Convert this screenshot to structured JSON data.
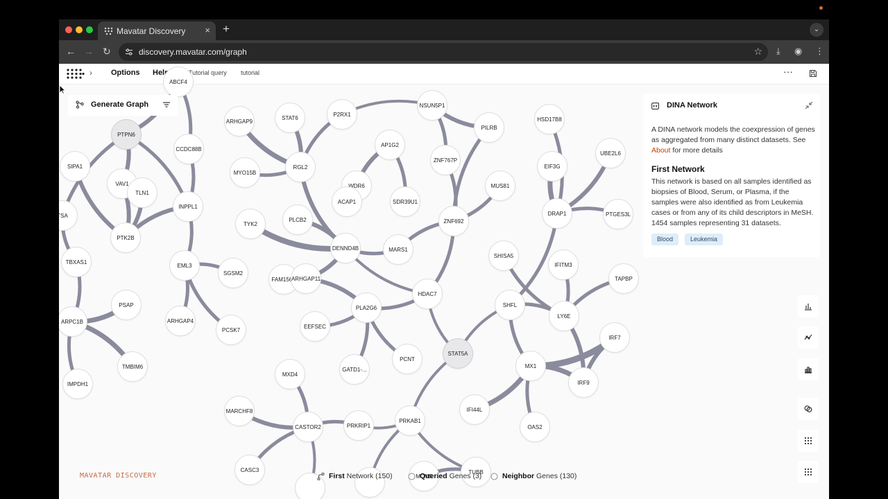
{
  "browser": {
    "tab_title": "Mavatar Discovery",
    "url": "discovery.mavatar.com/graph"
  },
  "app": {
    "menu": [
      "Options",
      "Help"
    ],
    "breadcrumbs": [
      "Tutorial query",
      "tutorial"
    ]
  },
  "toolbar": {
    "generate_label": "Generate Graph"
  },
  "panel": {
    "title": "DINA Network",
    "desc_before_link": "A DINA network models the coexpression of genes as aggregated from many distinct datasets. See ",
    "link": "About",
    "desc_after_link": " for more details",
    "section_title": "First Network",
    "section_desc": "This network is based on all samples identified as biopsies of Blood, Serum, or Plasma, if the samples were also identified as from Leukemia cases or from any of its child descriptors in MeSH. 1454 samples representing 31 datasets.",
    "tags": [
      "Blood",
      "Leukemia"
    ]
  },
  "brand": "MAVATAR DISCOVERY",
  "legend": {
    "first_bold": "First",
    "first_rest": " Network (150)",
    "queried_bold": "Queried",
    "queried_rest": " Genes (3)",
    "neighbor_bold": "Neighbor",
    "neighbor_rest": " Genes (130)"
  },
  "colors": {
    "edge": "#8a8b9c",
    "accent_link": "#c2410c",
    "brand": "#c46a4a",
    "tag_bg": "#e0ecf8"
  },
  "icons": {
    "generate": "graph-share-icon",
    "filter": "filter-lines-icon",
    "panel_close": "collapse-arrows-icon",
    "side_tools": [
      "bar-chart-icon",
      "scatter-icon",
      "histogram-icon",
      "circles-overlap-icon",
      "grid-dots-icon",
      "grid-dots-icon"
    ]
  },
  "graph": {
    "nodes": [
      {
        "id": "ABC",
        "label": "ABCF4",
        "q": false
      },
      {
        "id": "PTPN6",
        "label": "PTPN6",
        "q": true
      },
      {
        "id": "CCDC88B",
        "label": "CCDC88B",
        "q": false
      },
      {
        "id": "ARHGAP9",
        "label": "ARHGAP9",
        "q": false
      },
      {
        "id": "STAT6",
        "label": "STAT6",
        "q": false
      },
      {
        "id": "P2RX1",
        "label": "P2RX1",
        "q": false
      },
      {
        "id": "NSUN5P1",
        "label": "NSUN5P1",
        "q": false
      },
      {
        "id": "PILRB",
        "label": "PILRB",
        "q": false
      },
      {
        "id": "HSD17B8",
        "label": "HSD17B8",
        "q": false
      },
      {
        "id": "UBE2L6",
        "label": "UBE2L6",
        "q": false
      },
      {
        "id": "SIPA1",
        "label": "SIPA1",
        "q": false
      },
      {
        "id": "VAV1",
        "label": "VAV1",
        "q": false
      },
      {
        "id": "TLN1",
        "label": "TLN1",
        "q": false
      },
      {
        "id": "INPPL1",
        "label": "INPPL1",
        "q": false
      },
      {
        "id": "MYO15B",
        "label": "MYO15B",
        "q": false
      },
      {
        "id": "RGL2",
        "label": "RGL2",
        "q": false
      },
      {
        "id": "AP1G2",
        "label": "AP1G2",
        "q": false
      },
      {
        "id": "ZNF767P",
        "label": "ZNF767P",
        "q": false
      },
      {
        "id": "EIF3G",
        "label": "EIF3G",
        "q": false
      },
      {
        "id": "WDR6",
        "label": "WDR6",
        "q": false
      },
      {
        "id": "ACAP1",
        "label": "ACAP1",
        "q": false
      },
      {
        "id": "SDR39U1",
        "label": "SDR39U1",
        "q": false
      },
      {
        "id": "MUS81",
        "label": "MUS81",
        "q": false
      },
      {
        "id": "TSA",
        "label": "TSA",
        "q": false
      },
      {
        "id": "PTK2B",
        "label": "PTK2B",
        "q": false
      },
      {
        "id": "TYK2",
        "label": "TYK2",
        "q": false
      },
      {
        "id": "PLCB2",
        "label": "PLCB2",
        "q": false
      },
      {
        "id": "ZNF692",
        "label": "ZNF692",
        "q": false
      },
      {
        "id": "DRAP1",
        "label": "DRAP1",
        "q": false
      },
      {
        "id": "PTGES3L",
        "label": "PTGES3L",
        "q": false
      },
      {
        "id": "DENND4B",
        "label": "DENND4B",
        "q": false
      },
      {
        "id": "MARS1",
        "label": "MARS1",
        "q": false
      },
      {
        "id": "TBXAS1",
        "label": "TBXAS1",
        "q": false
      },
      {
        "id": "EML3",
        "label": "EML3",
        "q": false
      },
      {
        "id": "SGSM2",
        "label": "SGSM2",
        "q": false
      },
      {
        "id": "FAM156B",
        "label": "FAM156B",
        "q": false
      },
      {
        "id": "ARHGAP11",
        "label": "ARHGAP11",
        "q": false
      },
      {
        "id": "SHISA5",
        "label": "SHISA5",
        "q": false
      },
      {
        "id": "IFITM3",
        "label": "IFITM3",
        "q": false
      },
      {
        "id": "TAPBP",
        "label": "TAPBP",
        "q": false
      },
      {
        "id": "HDAC7",
        "label": "HDAC7",
        "q": false
      },
      {
        "id": "PSAP",
        "label": "PSAP",
        "q": false
      },
      {
        "id": "ARPC1B",
        "label": "ARPC1B",
        "q": false
      },
      {
        "id": "ARHGAP4",
        "label": "ARHGAP4",
        "q": false
      },
      {
        "id": "PCSK7",
        "label": "PCSK7",
        "q": false
      },
      {
        "id": "PLA2G6",
        "label": "PLA2G6",
        "q": false
      },
      {
        "id": "SHFL",
        "label": "SHFL",
        "q": false
      },
      {
        "id": "LY6E",
        "label": "LY6E",
        "q": false
      },
      {
        "id": "EEFSEC",
        "label": "EEFSEC",
        "q": false
      },
      {
        "id": "IRF7",
        "label": "IRF7",
        "q": false
      },
      {
        "id": "STAT5A",
        "label": "STAT5A",
        "q": true
      },
      {
        "id": "PCNT",
        "label": "PCNT",
        "q": false
      },
      {
        "id": "TMBIM6",
        "label": "TMBIM6",
        "q": false
      },
      {
        "id": "GATD1",
        "label": "GATD1-...",
        "q": false
      },
      {
        "id": "MX1",
        "label": "MX1",
        "q": false
      },
      {
        "id": "MXD4",
        "label": "MXD4",
        "q": false
      },
      {
        "id": "IRF9",
        "label": "IRF9",
        "q": false
      },
      {
        "id": "IMPDH1",
        "label": "IMPDH1",
        "q": false
      },
      {
        "id": "IFI44L",
        "label": "IFI44L",
        "q": false
      },
      {
        "id": "MARCHF8",
        "label": "MARCHF8",
        "q": false
      },
      {
        "id": "CASTOR2",
        "label": "CASTOR2",
        "q": false
      },
      {
        "id": "PRKRIP1",
        "label": "PRKRIP1",
        "q": false
      },
      {
        "id": "PRKAB1",
        "label": "PRKAB1",
        "q": false
      },
      {
        "id": "OAS2",
        "label": "OAS2",
        "q": false
      },
      {
        "id": "CASC3",
        "label": "CASC3",
        "q": false
      },
      {
        "id": "MCM5",
        "label": "MCM5",
        "q": false
      },
      {
        "id": "TUBB",
        "label": "TUBB",
        "q": false
      },
      {
        "id": "B1",
        "label": "",
        "q": false
      },
      {
        "id": "B2",
        "label": "",
        "q": false
      }
    ],
    "edges": [
      {
        "s": "PTPN6",
        "t": "ABC",
        "w": 6
      },
      {
        "s": "PTPN6",
        "t": "INPPL1",
        "w": 5
      },
      {
        "s": "PTPN6",
        "t": "TSA",
        "w": 5
      },
      {
        "s": "PTPN6",
        "t": "VAV1",
        "w": 6
      },
      {
        "s": "CCDC88B",
        "t": "ABC",
        "w": 5
      },
      {
        "s": "CCDC88B",
        "t": "INPPL1",
        "w": 5
      },
      {
        "s": "SIPA1",
        "t": "PTK2B",
        "w": 6
      },
      {
        "s": "VAV1",
        "t": "PTK2B",
        "w": 6
      },
      {
        "s": "VAV1",
        "t": "TLN1",
        "w": 6
      },
      {
        "s": "TLN1",
        "t": "PTK2B",
        "w": 6
      },
      {
        "s": "INPPL1",
        "t": "PTK2B",
        "w": 6
      },
      {
        "s": "INPPL1",
        "t": "EML3",
        "w": 5
      },
      {
        "s": "TSA",
        "t": "TBXAS1",
        "w": 5
      },
      {
        "s": "TBXAS1",
        "t": "ARPC1B",
        "w": 5
      },
      {
        "s": "ARPC1B",
        "t": "PSAP",
        "w": 7
      },
      {
        "s": "ARPC1B",
        "t": "TMBIM6",
        "w": 7
      },
      {
        "s": "ARPC1B",
        "t": "IMPDH1",
        "w": 5
      },
      {
        "s": "EML3",
        "t": "SGSM2",
        "w": 5
      },
      {
        "s": "EML3",
        "t": "PCSK7",
        "w": 5
      },
      {
        "s": "EML3",
        "t": "ARHGAP4",
        "w": 5
      },
      {
        "s": "ARHGAP9",
        "t": "RGL2",
        "w": 7
      },
      {
        "s": "STAT6",
        "t": "RGL2",
        "w": 6
      },
      {
        "s": "MYO15B",
        "t": "RGL2",
        "w": 5
      },
      {
        "s": "RGL2",
        "t": "P2RX1",
        "w": 5
      },
      {
        "s": "RGL2",
        "t": "DENND4B",
        "w": 6
      },
      {
        "s": "P2RX1",
        "t": "NSUN5P1",
        "w": 4
      },
      {
        "s": "NSUN5P1",
        "t": "PILRB",
        "w": 6
      },
      {
        "s": "NSUN5P1",
        "t": "ZNF767P",
        "w": 5
      },
      {
        "s": "AP1G2",
        "t": "WDR6",
        "w": 6
      },
      {
        "s": "AP1G2",
        "t": "SDR39U1",
        "w": 5
      },
      {
        "s": "WDR6",
        "t": "ACAP1",
        "w": 5
      },
      {
        "s": "ZNF767P",
        "t": "ZNF692",
        "w": 5
      },
      {
        "s": "PILRB",
        "t": "ZNF692",
        "w": 5
      },
      {
        "s": "MUS81",
        "t": "ZNF692",
        "w": 5
      },
      {
        "s": "ZNF692",
        "t": "MARS1",
        "w": 5
      },
      {
        "s": "ZNF692",
        "t": "HDAC7",
        "w": 5
      },
      {
        "s": "TYK2",
        "t": "DENND4B",
        "w": 8
      },
      {
        "s": "PLCB2",
        "t": "DENND4B",
        "w": 6
      },
      {
        "s": "DENND4B",
        "t": "MARS1",
        "w": 5
      },
      {
        "s": "DENND4B",
        "t": "ARHGAP11",
        "w": 6
      },
      {
        "s": "DENND4B",
        "t": "HDAC7",
        "w": 4
      },
      {
        "s": "ARHGAP11",
        "t": "PLA2G6",
        "w": 6
      },
      {
        "s": "PLA2G6",
        "t": "HDAC7",
        "w": 5
      },
      {
        "s": "PLA2G6",
        "t": "EEFSEC",
        "w": 5
      },
      {
        "s": "PLA2G6",
        "t": "PCNT",
        "w": 5
      },
      {
        "s": "PLA2G6",
        "t": "GATD1",
        "w": 5
      },
      {
        "s": "HDAC7",
        "t": "STAT5A",
        "w": 4
      },
      {
        "s": "STAT5A",
        "t": "SHFL",
        "w": 4
      },
      {
        "s": "STAT5A",
        "t": "PRKAB1",
        "w": 4
      },
      {
        "s": "HSD17B8",
        "t": "DRAP1",
        "w": 5
      },
      {
        "s": "EIF3G",
        "t": "DRAP1",
        "w": 7
      },
      {
        "s": "UBE2L6",
        "t": "DRAP1",
        "w": 6
      },
      {
        "s": "PTGES3L",
        "t": "DRAP1",
        "w": 5
      },
      {
        "s": "DRAP1",
        "t": "SHFL",
        "w": 5
      },
      {
        "s": "SHISA5",
        "t": "LY6E",
        "w": 5
      },
      {
        "s": "IFITM3",
        "t": "LY6E",
        "w": 5
      },
      {
        "s": "TAPBP",
        "t": "LY6E",
        "w": 5
      },
      {
        "s": "SHFL",
        "t": "LY6E",
        "w": 5
      },
      {
        "s": "SHFL",
        "t": "MX1",
        "w": 5
      },
      {
        "s": "LY6E",
        "t": "IRF9",
        "w": 6
      },
      {
        "s": "MX1",
        "t": "IRF7",
        "w": 9
      },
      {
        "s": "MX1",
        "t": "IRF9",
        "w": 7
      },
      {
        "s": "IRF7",
        "t": "IRF9",
        "w": 6
      },
      {
        "s": "MX1",
        "t": "IFI44L",
        "w": 7
      },
      {
        "s": "MX1",
        "t": "OAS2",
        "w": 5
      },
      {
        "s": "PRKAB1",
        "t": "PRKRIP1",
        "w": 4
      },
      {
        "s": "PRKRIP1",
        "t": "CASTOR2",
        "w": 5
      },
      {
        "s": "MXD4",
        "t": "CASTOR2",
        "w": 5
      },
      {
        "s": "MARCHF8",
        "t": "CASTOR2",
        "w": 6
      },
      {
        "s": "CASC3",
        "t": "CASTOR2",
        "w": 5
      },
      {
        "s": "PRKAB1",
        "t": "TUBB",
        "w": 4
      },
      {
        "s": "MCM5",
        "t": "TUBB",
        "w": 5
      },
      {
        "s": "PRKAB1",
        "t": "B2",
        "w": 4
      },
      {
        "s": "CASTOR2",
        "t": "B1",
        "w": 4
      }
    ]
  }
}
